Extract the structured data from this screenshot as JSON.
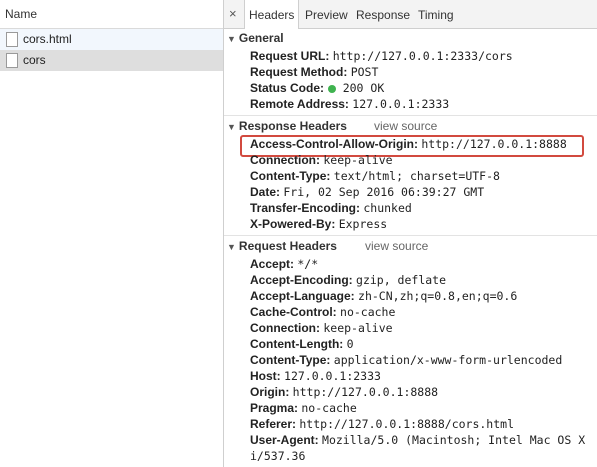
{
  "left_panel": {
    "header": "Name",
    "files": [
      {
        "name": "cors.html"
      },
      {
        "name": "cors"
      }
    ]
  },
  "tabs": {
    "close": "×",
    "items": [
      "Headers",
      "Preview",
      "Response",
      "Timing"
    ],
    "active": "Headers"
  },
  "general": {
    "title": "General",
    "rows": [
      {
        "key": "Request URL:",
        "value": "http://127.0.0.1:2333/cors"
      },
      {
        "key": "Request Method:",
        "value": "POST"
      },
      {
        "key": "Status Code:",
        "value": "200 OK",
        "status_color": "#3fb34f"
      },
      {
        "key": "Remote Address:",
        "value": "127.0.0.1:2333"
      }
    ]
  },
  "response_headers": {
    "title": "Response Headers",
    "view_source": "view source",
    "highlight_color": "#d24a3f",
    "rows": [
      {
        "key": "Access-Control-Allow-Origin:",
        "value": "http://127.0.0.1:8888"
      },
      {
        "key": "Connection:",
        "value": "keep-alive"
      },
      {
        "key": "Content-Type:",
        "value": "text/html; charset=UTF-8"
      },
      {
        "key": "Date:",
        "value": "Fri, 02 Sep 2016 06:39:27 GMT"
      },
      {
        "key": "Transfer-Encoding:",
        "value": "chunked"
      },
      {
        "key": "X-Powered-By:",
        "value": "Express"
      }
    ]
  },
  "request_headers": {
    "title": "Request Headers",
    "view_source": "view source",
    "rows": [
      {
        "key": "Accept:",
        "value": "*/*"
      },
      {
        "key": "Accept-Encoding:",
        "value": "gzip, deflate"
      },
      {
        "key": "Accept-Language:",
        "value": "zh-CN,zh;q=0.8,en;q=0.6"
      },
      {
        "key": "Cache-Control:",
        "value": "no-cache"
      },
      {
        "key": "Connection:",
        "value": "keep-alive"
      },
      {
        "key": "Content-Length:",
        "value": "0"
      },
      {
        "key": "Content-Type:",
        "value": "application/x-www-form-urlencoded"
      },
      {
        "key": "Host:",
        "value": "127.0.0.1:2333"
      },
      {
        "key": "Origin:",
        "value": "http://127.0.0.1:8888"
      },
      {
        "key": "Pragma:",
        "value": "no-cache"
      },
      {
        "key": "Referer:",
        "value": "http://127.0.0.1:8888/cors.html"
      },
      {
        "key": "User-Agent:",
        "value": "Mozilla/5.0 (Macintosh; Intel Mac OS X"
      }
    ],
    "continuation": "i/537.36"
  }
}
